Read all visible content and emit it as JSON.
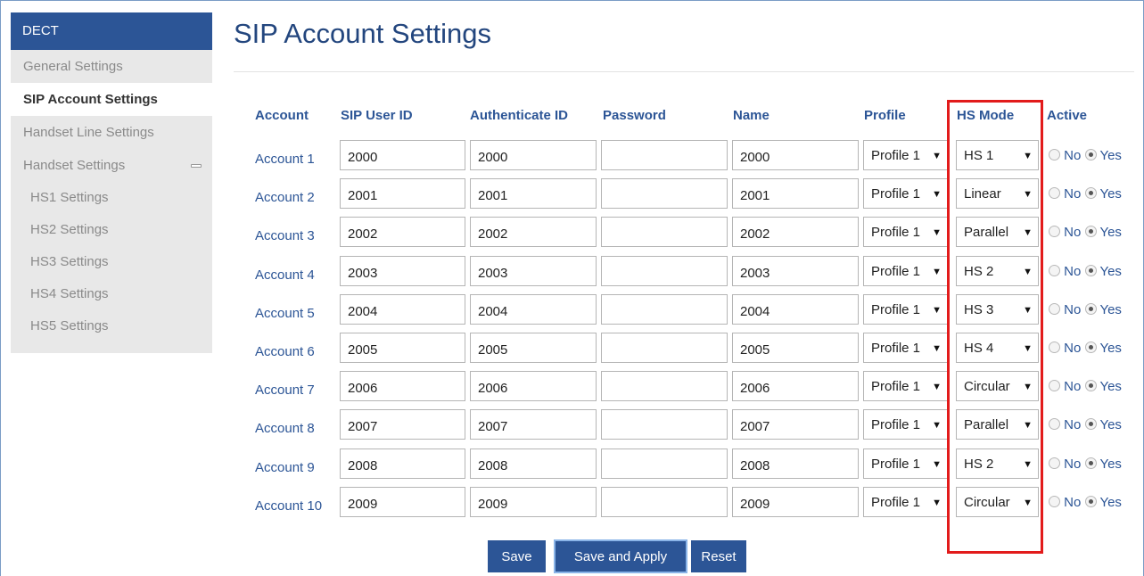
{
  "sidebar": {
    "header": "DECT",
    "items": [
      {
        "label": "General Settings"
      },
      {
        "label": "SIP Account Settings"
      },
      {
        "label": "Handset Line Settings"
      },
      {
        "label": "Handset Settings"
      },
      {
        "label": "HS1 Settings"
      },
      {
        "label": "HS2 Settings"
      },
      {
        "label": "HS3 Settings"
      },
      {
        "label": "HS4 Settings"
      },
      {
        "label": "HS5 Settings"
      }
    ]
  },
  "page": {
    "title": "SIP Account Settings"
  },
  "table": {
    "headers": {
      "account": "Account",
      "sip_user_id": "SIP User ID",
      "authenticate_id": "Authenticate ID",
      "password": "Password",
      "name": "Name",
      "profile": "Profile",
      "hs_mode": "HS Mode",
      "active": "Active"
    },
    "radio_no": "No",
    "radio_yes": "Yes",
    "rows": [
      {
        "account": "Account 1",
        "sip_user_id": "2000",
        "authenticate_id": "2000",
        "password": "",
        "name": "2000",
        "profile": "Profile 1",
        "hs_mode": "HS 1",
        "active": "Yes"
      },
      {
        "account": "Account 2",
        "sip_user_id": "2001",
        "authenticate_id": "2001",
        "password": "",
        "name": "2001",
        "profile": "Profile 1",
        "hs_mode": "Linear",
        "active": "Yes"
      },
      {
        "account": "Account 3",
        "sip_user_id": "2002",
        "authenticate_id": "2002",
        "password": "",
        "name": "2002",
        "profile": "Profile 1",
        "hs_mode": "Parallel",
        "active": "Yes"
      },
      {
        "account": "Account 4",
        "sip_user_id": "2003",
        "authenticate_id": "2003",
        "password": "",
        "name": "2003",
        "profile": "Profile 1",
        "hs_mode": "HS 2",
        "active": "Yes"
      },
      {
        "account": "Account 5",
        "sip_user_id": "2004",
        "authenticate_id": "2004",
        "password": "",
        "name": "2004",
        "profile": "Profile 1",
        "hs_mode": "HS 3",
        "active": "Yes"
      },
      {
        "account": "Account 6",
        "sip_user_id": "2005",
        "authenticate_id": "2005",
        "password": "",
        "name": "2005",
        "profile": "Profile 1",
        "hs_mode": "HS 4",
        "active": "Yes"
      },
      {
        "account": "Account 7",
        "sip_user_id": "2006",
        "authenticate_id": "2006",
        "password": "",
        "name": "2006",
        "profile": "Profile 1",
        "hs_mode": "Circular",
        "active": "Yes"
      },
      {
        "account": "Account 8",
        "sip_user_id": "2007",
        "authenticate_id": "2007",
        "password": "",
        "name": "2007",
        "profile": "Profile 1",
        "hs_mode": "Parallel",
        "active": "Yes"
      },
      {
        "account": "Account 9",
        "sip_user_id": "2008",
        "authenticate_id": "2008",
        "password": "",
        "name": "2008",
        "profile": "Profile 1",
        "hs_mode": "HS 2",
        "active": "Yes"
      },
      {
        "account": "Account 10",
        "sip_user_id": "2009",
        "authenticate_id": "2009",
        "password": "",
        "name": "2009",
        "profile": "Profile 1",
        "hs_mode": "Circular",
        "active": "Yes"
      }
    ]
  },
  "buttons": {
    "save": "Save",
    "save_and_apply": "Save and Apply",
    "reset": "Reset"
  },
  "colors": {
    "accent": "#2c5596",
    "highlight": "#e21b1b"
  },
  "icons": {
    "dropdown": "triangle-down-icon",
    "collapse": "collapse-icon"
  }
}
